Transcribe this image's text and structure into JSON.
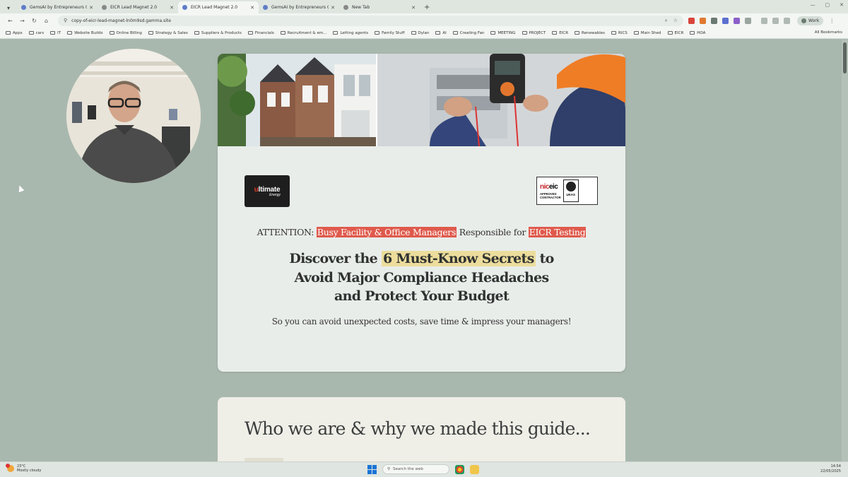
{
  "browser": {
    "tabs": [
      {
        "title": "GemsAI by Entrepreneurs Circle",
        "icon": "gem-favicon",
        "active": false
      },
      {
        "title": "EICR Lead Magnet 2.0",
        "icon": "globe-favicon",
        "active": false
      },
      {
        "title": "EICR Lead Magnet 2.0",
        "icon": "gem-favicon",
        "active": true
      },
      {
        "title": "GemsAI by Entrepreneurs Circle",
        "icon": "gem-favicon",
        "active": false
      },
      {
        "title": "New Tab",
        "icon": "chrome-favicon",
        "active": false
      }
    ],
    "url": "copy-of-eicr-lead-magnet-ln0m9sd.gamma.site",
    "profile_label": "Work",
    "bookmarks": [
      "Apps",
      "cars",
      "IT",
      "Website Builds",
      "Online Billing",
      "Strategy & Sales",
      "Suppliers & Products",
      "Financials",
      "Recruitment & em...",
      "Letting agents",
      "Family Stuff",
      "Dylan",
      "AI",
      "Creating Fan",
      "MEETING",
      "PROJECT",
      "EICR",
      "Renewables",
      "RICS",
      "Main Shed",
      "EICR",
      "HOA"
    ],
    "all_bookmarks_label": "All Bookmarks"
  },
  "page": {
    "logo_ue": {
      "word_prefix": "u",
      "word_rest": "ltimate",
      "sub": "Energy"
    },
    "logo_niceic": {
      "word_left": "nic",
      "word_right": "eic",
      "line1": "APPROVED",
      "line2": "CONTRACTOR",
      "ukas": "UKAS"
    },
    "attention": {
      "prefix": "ATTENTION:",
      "highlight1": "Busy Facility & Office Managers",
      "middle": "Responsible for",
      "highlight2": "EICR Testing"
    },
    "headline": {
      "pre": "Discover the",
      "highlight": "6 Must-Know Secrets",
      "post": "to",
      "line2": "Avoid Major Compliance Headaches",
      "line3": "and Protect Your Budget"
    },
    "subline": "So you can avoid unexpected costs, save time & impress your managers!",
    "section2_title": "Who we are & why we made this guide..."
  },
  "taskbar": {
    "temperature": "23°C",
    "weather": "Mostly cloudy",
    "search_placeholder": "Search the web",
    "time": "14:54",
    "date": "22/05/2025"
  },
  "colors": {
    "page_bg": "#a9b8ae",
    "highlight_red": "#df5a4c",
    "highlight_yellow": "#ecdd9c"
  }
}
